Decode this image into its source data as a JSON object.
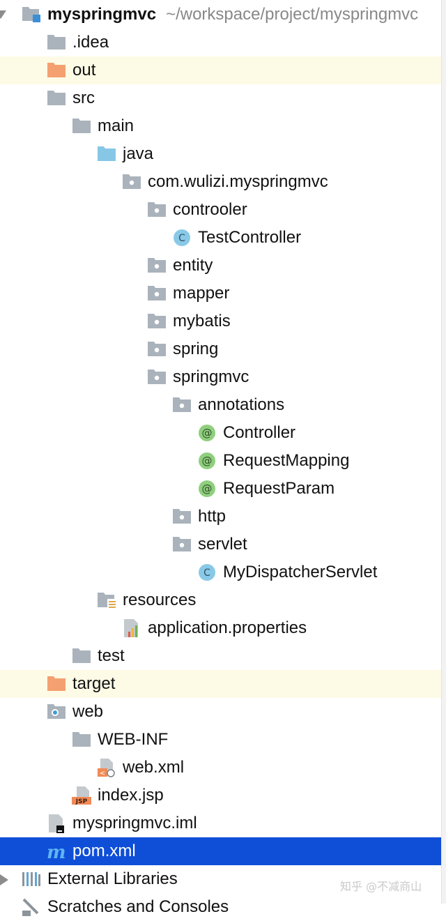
{
  "project": {
    "name": "myspringmvc",
    "path": "~/workspace/project/myspringmvc"
  },
  "tree": [
    {
      "label": ".idea",
      "icon": "folder-gray",
      "arrow": "right"
    },
    {
      "label": "out",
      "icon": "folder-orange",
      "arrow": "right",
      "highlight": true
    },
    {
      "label": "src",
      "icon": "folder-gray",
      "arrow": "down"
    },
    {
      "label": "main",
      "icon": "folder-gray",
      "arrow": "down"
    },
    {
      "label": "java",
      "icon": "folder-source",
      "arrow": "down"
    },
    {
      "label": "com.wulizi.myspringmvc",
      "icon": "package",
      "arrow": "down"
    },
    {
      "label": "controoler",
      "icon": "package",
      "arrow": "down"
    },
    {
      "label": "TestController",
      "icon": "class",
      "arrow": "none"
    },
    {
      "label": "entity",
      "icon": "package",
      "arrow": "right"
    },
    {
      "label": "mapper",
      "icon": "package",
      "arrow": "right"
    },
    {
      "label": "mybatis",
      "icon": "package",
      "arrow": "right"
    },
    {
      "label": "spring",
      "icon": "package",
      "arrow": "right"
    },
    {
      "label": "springmvc",
      "icon": "package",
      "arrow": "down"
    },
    {
      "label": "annotations",
      "icon": "package",
      "arrow": "down"
    },
    {
      "label": "Controller",
      "icon": "annotation",
      "arrow": "none"
    },
    {
      "label": "RequestMapping",
      "icon": "annotation",
      "arrow": "none"
    },
    {
      "label": "RequestParam",
      "icon": "annotation",
      "arrow": "none"
    },
    {
      "label": "http",
      "icon": "package",
      "arrow": "right"
    },
    {
      "label": "servlet",
      "icon": "package",
      "arrow": "down"
    },
    {
      "label": "MyDispatcherServlet",
      "icon": "class",
      "arrow": "none"
    },
    {
      "label": "resources",
      "icon": "folder-resources",
      "arrow": "down"
    },
    {
      "label": "application.properties",
      "icon": "properties-file",
      "arrow": "none"
    },
    {
      "label": "test",
      "icon": "folder-gray",
      "arrow": "right"
    },
    {
      "label": "target",
      "icon": "folder-orange",
      "arrow": "right",
      "highlight": true
    },
    {
      "label": "web",
      "icon": "folder-web",
      "arrow": "down"
    },
    {
      "label": "WEB-INF",
      "icon": "folder-gray",
      "arrow": "down"
    },
    {
      "label": "web.xml",
      "icon": "xml-file",
      "arrow": "none"
    },
    {
      "label": "index.jsp",
      "icon": "jsp-file",
      "arrow": "none"
    },
    {
      "label": "myspringmvc.iml",
      "icon": "iml-file",
      "arrow": "none"
    },
    {
      "label": "pom.xml",
      "icon": "maven-file",
      "arrow": "none",
      "selected": true
    },
    {
      "label": "External Libraries",
      "icon": "libraries",
      "arrow": "right"
    },
    {
      "label": "Scratches and Consoles",
      "icon": "scratches",
      "arrow": "none"
    }
  ],
  "watermark": "知乎 @不减商山",
  "colors": {
    "selection": "#0f4fd8",
    "highlight_row": "#fdfbe6",
    "folder_gray": "#aab3bb",
    "folder_orange": "#f4a070",
    "folder_source": "#87c7e6",
    "class_icon": "#89c9e8",
    "annotation_icon": "#8fcf7e"
  }
}
